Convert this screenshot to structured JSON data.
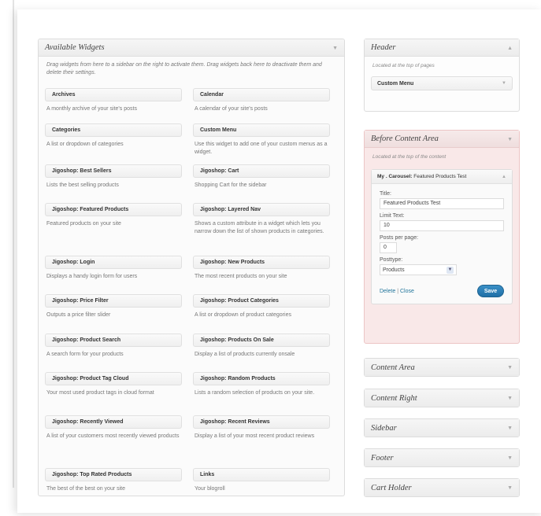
{
  "available": {
    "title": "Available Widgets",
    "description": "Drag widgets from here to a sidebar on the right to activate them. Drag widgets back here to deactivate them and delete their settings.",
    "widgets": [
      {
        "title": "Archives",
        "desc": "A monthly archive of your site's posts"
      },
      {
        "title": "Calendar",
        "desc": "A calendar of your site's posts"
      },
      {
        "title": "Categories",
        "desc": "A list or dropdown of categories"
      },
      {
        "title": "Custom Menu",
        "desc": "Use this widget to add one of your custom menus as a widget."
      },
      {
        "title": "Jigoshop: Best Sellers",
        "desc": "Lists the best selling products"
      },
      {
        "title": "Jigoshop: Cart",
        "desc": "Shopping Cart for the sidebar"
      },
      {
        "title": "Jigoshop: Featured Products",
        "desc": "Featured products on your site"
      },
      {
        "title": "Jigoshop: Layered Nav",
        "desc": "Shows a custom attribute in a widget which lets you narrow down the list of shown products in categories."
      },
      {
        "title": "Jigoshop: Login",
        "desc": "Displays a handy login form for users"
      },
      {
        "title": "Jigoshop: New Products",
        "desc": "The most recent products on your site"
      },
      {
        "title": "Jigoshop: Price Filter",
        "desc": "Outputs a price filter slider"
      },
      {
        "title": "Jigoshop: Product Categories",
        "desc": "A list or dropdown of product categories"
      },
      {
        "title": "Jigoshop: Product Search",
        "desc": "A search form for your products"
      },
      {
        "title": "Jigoshop: Products On Sale",
        "desc": "Display a list of products currently onsale"
      },
      {
        "title": "Jigoshop: Product Tag Cloud",
        "desc": "Your most used product tags in cloud format"
      },
      {
        "title": "Jigoshop: Random Products",
        "desc": "Lists a random selection of products on your site."
      },
      {
        "title": "Jigoshop: Recently Viewed",
        "desc": "A list of your customers most recently viewed products"
      },
      {
        "title": "Jigoshop: Recent Reviews",
        "desc": "Display a list of your most recent product reviews"
      },
      {
        "title": "Jigoshop: Top Rated Products",
        "desc": "The best of the best on your site"
      },
      {
        "title": "Links",
        "desc": "Your blogroll"
      }
    ]
  },
  "header_area": {
    "title": "Header",
    "description": "Located at the top of pages",
    "widget": "Custom Menu"
  },
  "before_content": {
    "title": "Before Content Area",
    "description": "Located at the top of the content",
    "widget_head_bold": "My . Carousel:",
    "widget_head_rest": "Featured Products Test",
    "form": {
      "title_label": "Title:",
      "title_value": "Featured Products Test",
      "limit_label": "Limit Text:",
      "limit_value": "10",
      "posts_label": "Posts per page:",
      "posts_value": "0",
      "posttype_label": "Posttype:",
      "posttype_value": "Products",
      "delete_label": "Delete",
      "separator": "|",
      "close_label": "Close",
      "save_label": "Save"
    }
  },
  "collapsed_areas": [
    "Content Area",
    "Content Right",
    "Sidebar",
    "Footer",
    "Cart Holder"
  ],
  "icons": {
    "collapse": "triangle-down-icon",
    "expand": "triangle-up-icon"
  }
}
